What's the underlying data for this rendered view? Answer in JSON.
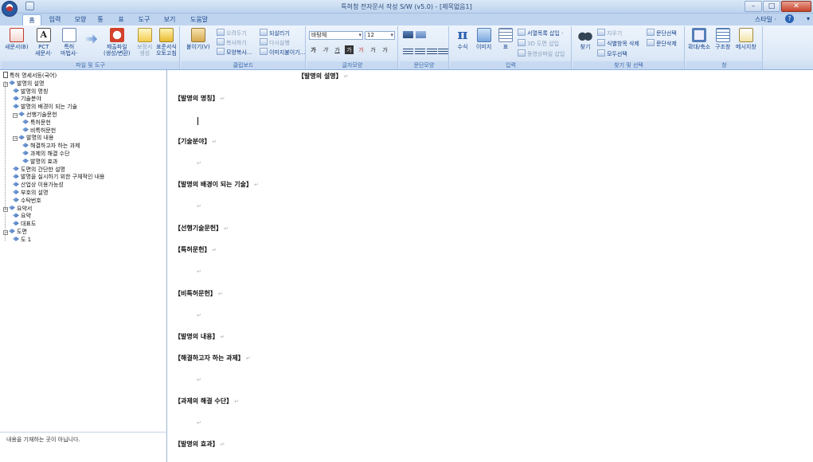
{
  "window": {
    "title": "특허청 전자문서 작성 S/W (v5.0) - [제목없음1]",
    "controls": {
      "minimize": "–",
      "maximize": "□",
      "close": "✕"
    }
  },
  "ribbon_tabs": [
    {
      "label": "홈",
      "active": true
    },
    {
      "label": "입력"
    },
    {
      "label": "모양"
    },
    {
      "label": "통"
    },
    {
      "label": "표"
    },
    {
      "label": "도구"
    },
    {
      "label": "보기"
    },
    {
      "label": "도움말"
    }
  ],
  "ribbon_right": {
    "style_label": "스타일 ·",
    "help_label": "?"
  },
  "groups": {
    "file": {
      "label": "파일 및 도구",
      "buttons": [
        "새문서(B)",
        "PCT\n새문서·",
        "특허\n마법사·",
        "제출파일\n(생성/변환)",
        "보정서\n생성",
        "표준서식\n오토고침"
      ]
    },
    "clipboard": {
      "label": "클립보드",
      "paste": "붙이기(V)",
      "items": [
        "오려두기",
        "복사하기",
        "모양복사...",
        "되살리기",
        "다시실행",
        "이미지붙이기..."
      ]
    },
    "font": {
      "label": "글자모양",
      "font_name": "바탕체",
      "font_size": "12",
      "format_buttons": [
        "가",
        "가",
        "가",
        "가",
        "가",
        "가",
        "가"
      ]
    },
    "paragraph": {
      "label": "문단모양"
    },
    "insert": {
      "label": "입력",
      "buttons": [
        "수식",
        "이미지",
        "표"
      ],
      "items": [
        "서열목록 삽입 ·",
        "3D 도면 삽입",
        "동영상파일 삽입"
      ]
    },
    "find": {
      "label": "찾기 및 선택",
      "find_button": "찾기",
      "items": [
        "지우기",
        "식별항목 삭제",
        "모두선택",
        "문단선택",
        "문단삭제"
      ]
    },
    "window_group": {
      "label": "창",
      "buttons": [
        "확대/축소",
        "구조창",
        "메시지창"
      ]
    }
  },
  "tree": [
    {
      "label": "특허 명세서등(국어)",
      "indent": 0,
      "icon": "doc"
    },
    {
      "label": "발명의 설명",
      "indent": 1,
      "toggle": "−"
    },
    {
      "label": "발명의 명칭",
      "indent": 2
    },
    {
      "label": "기술분야",
      "indent": 2
    },
    {
      "label": "발명의 배경이 되는 기술",
      "indent": 2
    },
    {
      "label": "선행기술문헌",
      "indent": 2,
      "toggle": "−"
    },
    {
      "label": "특허문헌",
      "indent": 3
    },
    {
      "label": "비특허문헌",
      "indent": 3
    },
    {
      "label": "발명의 내용",
      "indent": 2,
      "toggle": "−"
    },
    {
      "label": "해결하고자 하는 과제",
      "indent": 3
    },
    {
      "label": "과제의 해결 수단",
      "indent": 3
    },
    {
      "label": "발명의 효과",
      "indent": 3
    },
    {
      "label": "도면의 간단한 설명",
      "indent": 2
    },
    {
      "label": "발명을 실시하기 위한 구체적인 내용",
      "indent": 2
    },
    {
      "label": "산업상 이용가능성",
      "indent": 2
    },
    {
      "label": "부호의 설명",
      "indent": 2
    },
    {
      "label": "수탁번호",
      "indent": 2
    },
    {
      "label": "요약서",
      "indent": 1,
      "toggle": "−"
    },
    {
      "label": "요약",
      "indent": 2
    },
    {
      "label": "대표도",
      "indent": 2
    },
    {
      "label": "도면",
      "indent": 1,
      "toggle": "−"
    },
    {
      "label": "도 1",
      "indent": 2
    }
  ],
  "status": {
    "message": "내용을 기재하는 곳이 아닙니다."
  },
  "document": {
    "paragraph_mark": "↵",
    "lines": [
      {
        "text": "【발명의 설명】"
      },
      {
        "text": "【발명의 명칭】"
      },
      {
        "text": "【기술분야】"
      },
      {
        "text": "【발명의 배경이 되는 기술】"
      },
      {
        "text": "【선행기술문헌】"
      },
      {
        "text": "【특허문헌】"
      },
      {
        "text": "【비특허문헌】"
      },
      {
        "text": "【발명의 내용】"
      },
      {
        "text": "【해결하고자 하는 과제】"
      },
      {
        "text": "【과제의 해결 수단】"
      },
      {
        "text": "【발명의 효과】"
      }
    ]
  }
}
